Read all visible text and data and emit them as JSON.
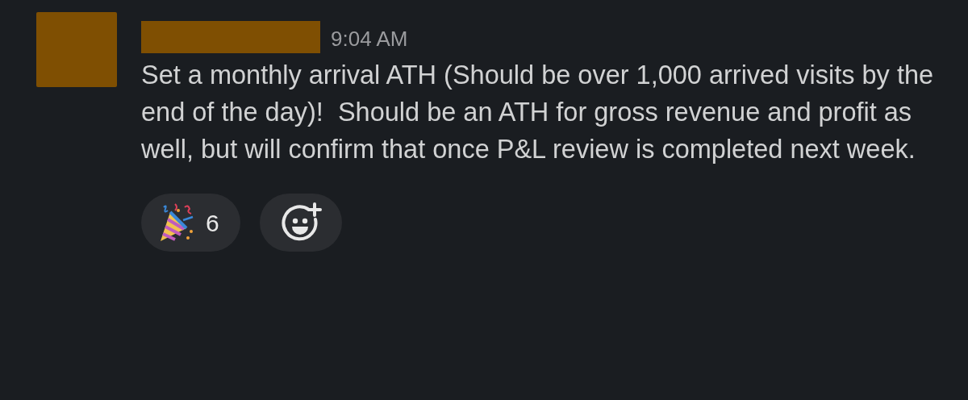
{
  "message": {
    "time": "9:04 AM",
    "text": "Set a monthly arrival ATH (Should be over 1,000 arrived visits by the end of the day)!  Should be an ATH for gross revenue and profit as well, but will confirm that once P&L review is completed next week.",
    "reactions": [
      {
        "count": "6"
      }
    ]
  }
}
